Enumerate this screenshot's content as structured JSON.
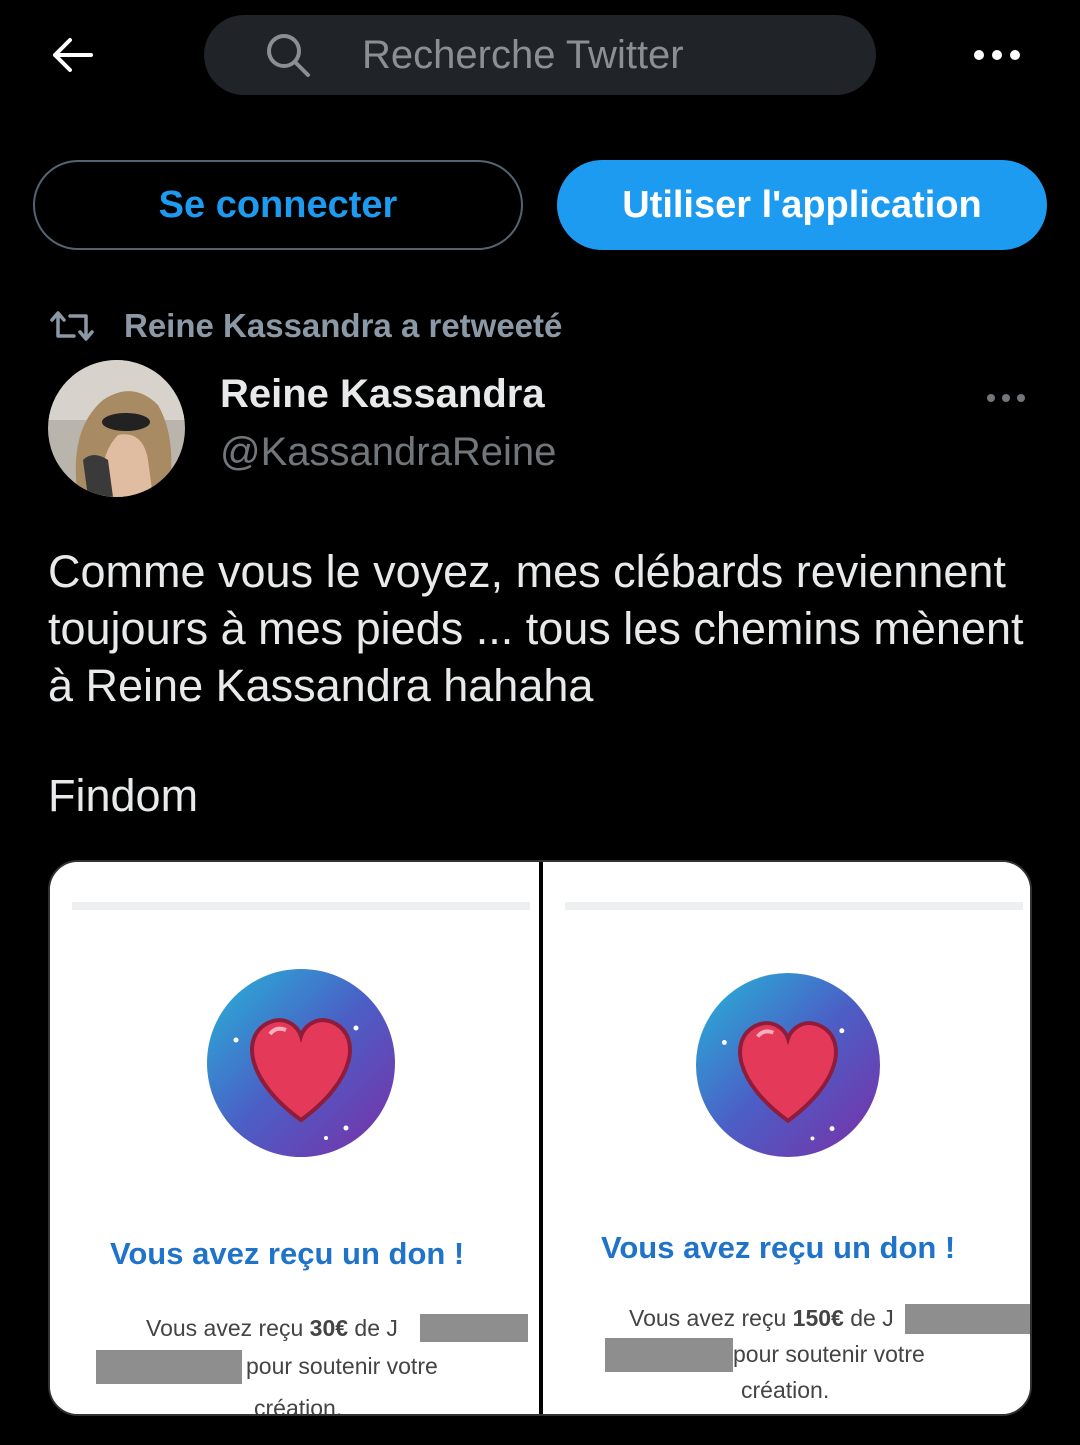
{
  "topbar": {
    "search_placeholder": "Recherche Twitter"
  },
  "buttons": {
    "login": "Se connecter",
    "use_app": "Utiliser l'application"
  },
  "tweet": {
    "retweet_label": "Reine Kassandra a retweeté",
    "author_name": "Reine Kassandra",
    "author_handle": "@KassandraReine",
    "text": "Comme vous le voyez, mes clébards reviennent toujours à mes pieds ... tous les chemins mènent à Reine Kassandra hahaha",
    "tag": "Findom"
  },
  "media": [
    {
      "title": "Vous avez reçu un don !",
      "line1_prefix": "Vous avez reçu ",
      "amount": "30€",
      "line1_suffix": " de J",
      "line2": "pour soutenir votre",
      "line3": "création."
    },
    {
      "title": "Vous avez reçu un don !",
      "line1_prefix": "Vous avez reçu ",
      "amount": "150€",
      "line1_suffix": " de J",
      "line2": "pour soutenir votre",
      "line3": "création."
    }
  ],
  "colors": {
    "accent": "#1d9bf0",
    "background": "#000000",
    "secondary_text": "#71767b"
  },
  "icons": {
    "back": "arrow-left-icon",
    "search": "search-icon",
    "more": "more-horizontal-icon",
    "retweet": "retweet-icon"
  }
}
